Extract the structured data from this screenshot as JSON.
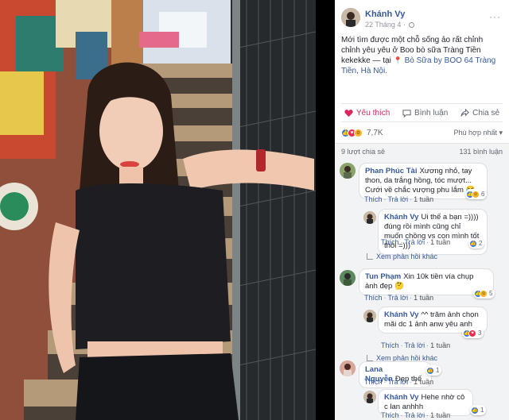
{
  "post": {
    "author": "Khánh Vy",
    "date": "22 Tháng 4",
    "text_main": "Mới tìm được một chỗ sống ảo rất chỉnh chỉnh yêu yêu ở Boo bò sữa Tràng Tiền kekekke — tại ",
    "location": "Bò Sữa by BOO 64 Tràng Tiền, Hà Nội."
  },
  "actions": {
    "like": "Yêu thích",
    "comment": "Bình luận",
    "share": "Chia sẻ"
  },
  "reactions": {
    "count": "7,7K",
    "sort_label": "Phù hợp nhất ▾"
  },
  "stats": {
    "shares": "9 lượt chia sẻ",
    "comments": "131 bình luận"
  },
  "comments": [
    {
      "name": "Phan Phúc Tài",
      "text": "Xương nhỏ, tay thon, da trắng hồng, tóc mượt... Cưới về chắc vượng phu lắm",
      "emoji": "😂",
      "like": "Thích",
      "reply": "Trả lời",
      "time": "1 tuần",
      "badge": "6",
      "replies": [
        {
          "name": "Khánh Vy",
          "text": "Ui thế a bạn =)))) đúng rồi mình cũng chỉ muốn chồng vs con mình tốt thôi =)))",
          "like": "Thích",
          "reply": "Trả lời",
          "time": "1 tuần",
          "badge": "2"
        }
      ],
      "more_replies": "Xem phản hồi khác"
    },
    {
      "name": "Tun Phạm",
      "text": "Xin 10k tiền vía chụp ảnh đẹp",
      "emoji": "🤔",
      "like": "Thích",
      "reply": "Trả lời",
      "time": "1 tuần",
      "badge": "5",
      "replies": [
        {
          "name": "Khánh Vy",
          "text": "^^ trăm ảnh chọn mãi dc 1 ảnh anw yêu anh",
          "like": "Thích",
          "reply": "Trả lời",
          "time": "1 tuần",
          "badge": "3"
        }
      ],
      "more_replies": "Xem phản hồi khác"
    },
    {
      "name": "Lana Nguyễn",
      "text": "Đẹp thế",
      "emoji": "",
      "like": "Thích",
      "reply": "Trả lời",
      "time": "1 tuần",
      "badge": "1",
      "replies": [
        {
          "name": "Khánh Vy",
          "text": "Hehe nhờ cô c lan anhhh",
          "like": "Thích",
          "reply": "Trả lời",
          "time": "1 tuần",
          "badge": "1"
        }
      ]
    }
  ],
  "colors": {
    "link": "#365899",
    "like_active": "#e0245e",
    "like_blue": "#3578e5",
    "love_red": "#f0284a",
    "bg_gray": "#f2f3f5"
  },
  "icons": [
    "heart-icon",
    "comment-icon",
    "share-icon",
    "like-reaction-icon",
    "love-reaction-icon",
    "wow-reaction-icon",
    "location-pin-icon",
    "globe-icon"
  ]
}
